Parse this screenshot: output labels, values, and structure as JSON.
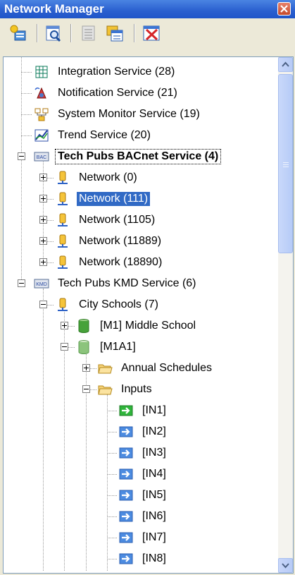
{
  "window": {
    "title": "Network Manager"
  },
  "toolbar": {
    "buttons": [
      {
        "name": "new-service-button",
        "icon": "new-service-icon"
      },
      {
        "name": "find-button",
        "icon": "find-icon"
      },
      {
        "name": "properties-button",
        "icon": "properties-icon"
      },
      {
        "name": "open-window-button",
        "icon": "open-window-icon"
      },
      {
        "name": "delete-button",
        "icon": "delete-icon"
      }
    ]
  },
  "tree": {
    "nodes": [
      {
        "label": "Integration Service (28)",
        "icon": "integration-icon"
      },
      {
        "label": "Notification Service (21)",
        "icon": "notification-icon"
      },
      {
        "label": "System Monitor Service (19)",
        "icon": "system-monitor-icon"
      },
      {
        "label": "Trend Service (20)",
        "icon": "trend-icon"
      },
      {
        "label": "Tech Pubs BACnet Service (4)",
        "icon": "bacnet-icon",
        "expanded": true
      },
      {
        "label": "Network (0)",
        "icon": "network-icon",
        "expanded": false
      },
      {
        "label": "Network (111)",
        "icon": "network-icon",
        "expanded": false,
        "selected": true
      },
      {
        "label": "Network (1105)",
        "icon": "network-icon",
        "expanded": false
      },
      {
        "label": "Network (11889)",
        "icon": "network-icon",
        "expanded": false
      },
      {
        "label": "Network (18890)",
        "icon": "network-icon",
        "expanded": false
      },
      {
        "label": "Tech Pubs KMD Service (6)",
        "icon": "kmd-icon",
        "expanded": true
      },
      {
        "label": "City Schools (7)",
        "icon": "network-icon",
        "expanded": true
      },
      {
        "label": "[M1] Middle School",
        "icon": "controller-icon",
        "expanded": false
      },
      {
        "label": "[M1A1]",
        "icon": "controller-icon",
        "expanded": true
      },
      {
        "label": "Annual Schedules",
        "icon": "folder-icon",
        "expanded": false
      },
      {
        "label": "Inputs",
        "icon": "folder-open-icon",
        "expanded": true
      },
      {
        "label": "[IN1]",
        "icon": "input-icon"
      },
      {
        "label": "[IN2]",
        "icon": "input-icon"
      },
      {
        "label": "[IN3]",
        "icon": "input-icon"
      },
      {
        "label": "[IN4]",
        "icon": "input-icon"
      },
      {
        "label": "[IN5]",
        "icon": "input-icon"
      },
      {
        "label": "[IN6]",
        "icon": "input-icon"
      },
      {
        "label": "[IN7]",
        "icon": "input-icon"
      },
      {
        "label": "[IN8]",
        "icon": "input-icon"
      }
    ]
  },
  "colors": {
    "selection": "#316ac5",
    "titlebar": "#2a5fcf"
  }
}
